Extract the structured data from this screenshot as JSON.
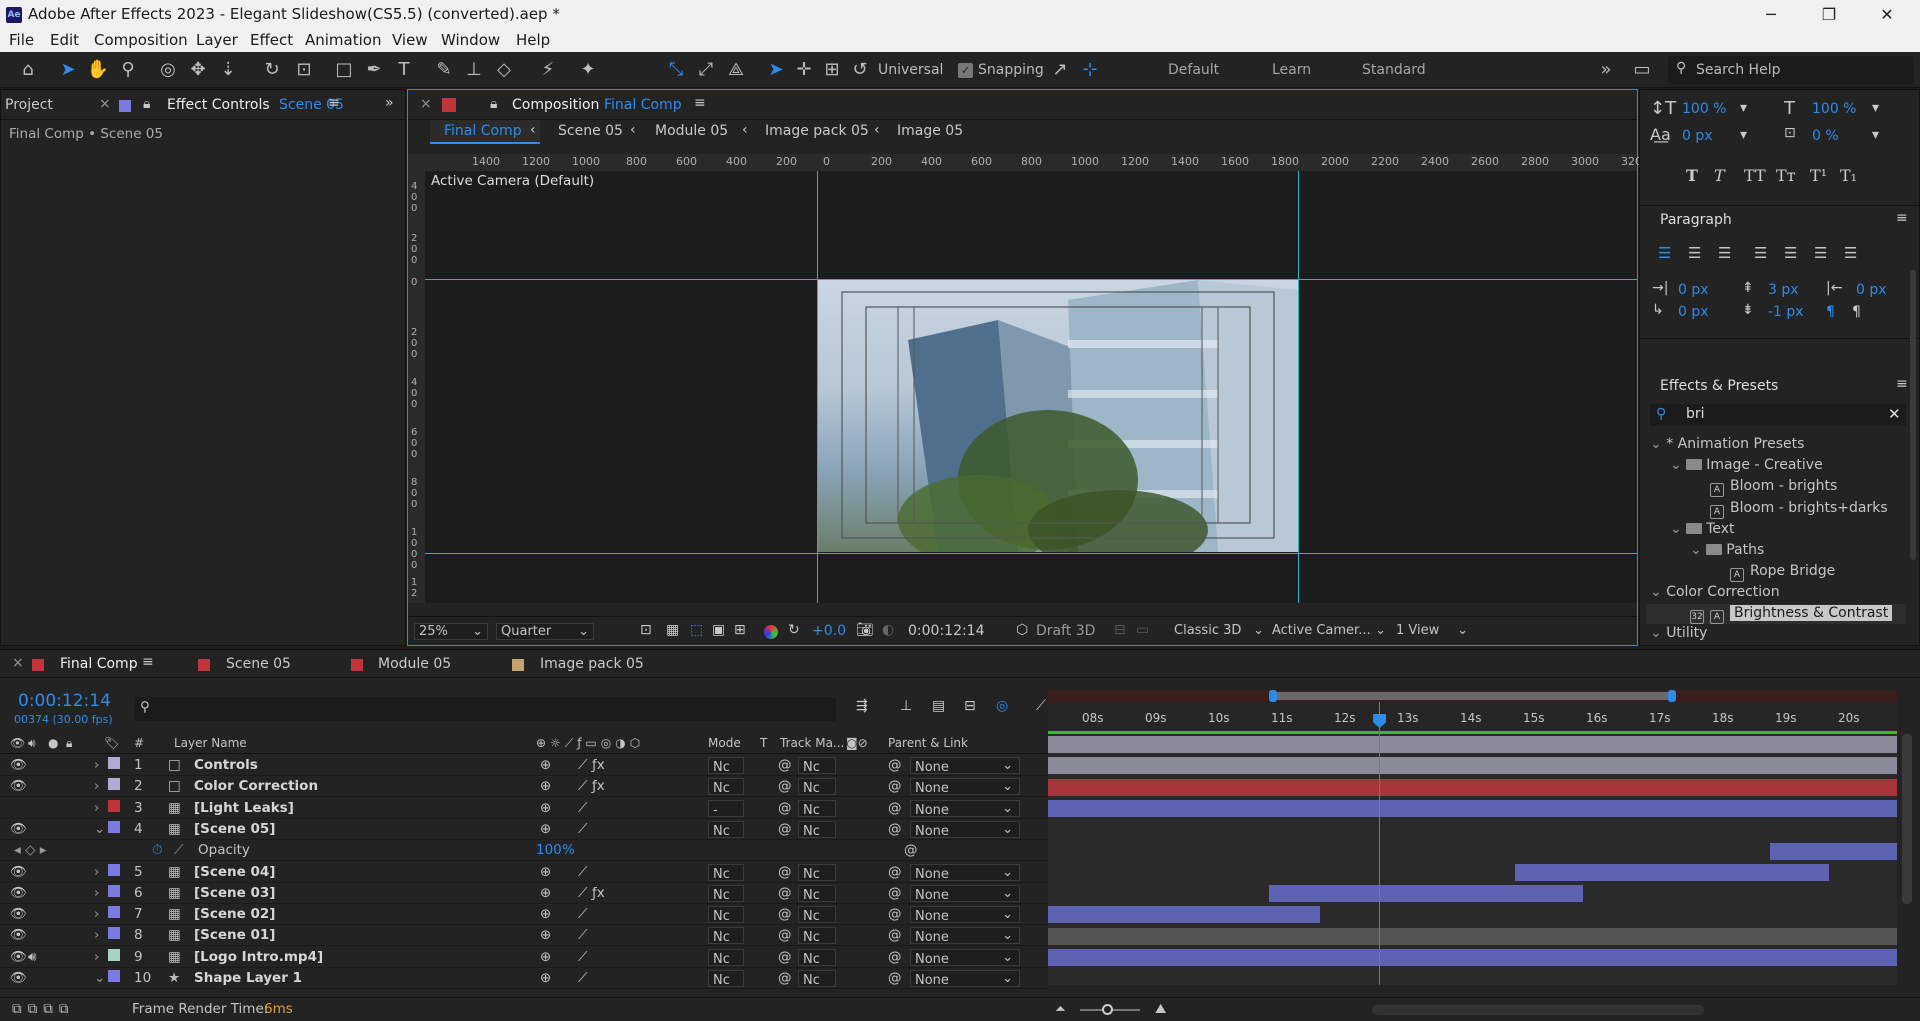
{
  "app": {
    "title": "Adobe After Effects 2023 - Elegant Slideshow(CS5.5) (converted).aep *",
    "logo": "Ae"
  },
  "window_controls": {
    "minimize": "─",
    "maximize": "❐",
    "close": "✕"
  },
  "menu": [
    "File",
    "Edit",
    "Composition",
    "Layer",
    "Effect",
    "Animation",
    "View",
    "Window",
    "Help"
  ],
  "toolbar": {
    "axis_mode": "Universal",
    "snapping": "Snapping",
    "workspaces": [
      "Default",
      "Learn",
      "Standard"
    ],
    "search_placeholder": "Search Help"
  },
  "left_panel": {
    "tab_project": "Project",
    "tab_effect_controls": "Effect Controls",
    "effect_controls_target": "Scene 05",
    "breadcrumb": "Final Comp • Scene 05"
  },
  "comp_panel": {
    "tab_label": "Composition",
    "comp_name": "Final Comp",
    "flow": [
      "Final Comp",
      "Scene 05",
      "Module 05",
      "Image pack 05",
      "Image 05"
    ],
    "camera_label": "Active Camera (Default)",
    "ruler_h": [
      "1400",
      "1200",
      "1000",
      "800",
      "600",
      "400",
      "200",
      "0",
      "200",
      "400",
      "600",
      "800",
      "1000",
      "1200",
      "1400",
      "1600",
      "1800",
      "2000",
      "2200",
      "2400",
      "2600",
      "2800",
      "3000",
      "320"
    ],
    "ruler_v": [
      "400",
      "200",
      "0",
      "200",
      "400",
      "600",
      "800",
      "1000",
      "12"
    ],
    "zoom": "25%",
    "resolution": "Quarter",
    "exposure": "+0.0",
    "timecode": "0:00:12:14",
    "renderer_draft": "Draft 3D",
    "renderer": "Classic 3D",
    "camera_select": "Active Camer...",
    "views": "1 View"
  },
  "character": {
    "vscale": "100 %",
    "hscale": "100 %",
    "baseline": "0 px",
    "tsume": "0 %",
    "styles": [
      "T",
      "T",
      "TT",
      "Tт",
      "T¹",
      "T₁"
    ]
  },
  "paragraph": {
    "title": "Paragraph",
    "indent_left": "0 px",
    "space_before": "3 px",
    "indent_right": "0 px",
    "indent_first": "0 px",
    "space_after": "-1 px"
  },
  "effects_presets": {
    "title": "Effects & Presets",
    "search": "bri",
    "tree": [
      {
        "label": "* Animation Presets",
        "level": 0,
        "kind": "group"
      },
      {
        "label": "Image - Creative",
        "level": 1,
        "kind": "folder"
      },
      {
        "label": "Bloom - brights",
        "level": 2,
        "kind": "preset"
      },
      {
        "label": "Bloom - brights+darks",
        "level": 2,
        "kind": "preset"
      },
      {
        "label": "Text",
        "level": 1,
        "kind": "folder"
      },
      {
        "label": "Paths",
        "level": 2,
        "kind": "folder"
      },
      {
        "label": "Rope Bridge",
        "level": 3,
        "kind": "preset"
      },
      {
        "label": "Color Correction",
        "level": 0,
        "kind": "group"
      },
      {
        "label": "Brightness & Contrast",
        "level": 1,
        "kind": "effect",
        "selected": true
      },
      {
        "label": "Utility",
        "level": 0,
        "kind": "group"
      }
    ]
  },
  "timeline": {
    "tabs": [
      "Final Comp",
      "Scene 05",
      "Module 05",
      "Image pack 05"
    ],
    "tab_colors": [
      "#c0343a",
      "#c0343a",
      "#c0343a",
      "#c4a46c"
    ],
    "timecode": "0:00:12:14",
    "frame_info": "00374 (30.00 fps)",
    "headers": {
      "hash": "#",
      "layer_name": "Layer Name",
      "mode": "Mode",
      "t": "T",
      "track": "Track Ma...",
      "parent": "Parent & Link"
    },
    "time_labels": [
      "08s",
      "09s",
      "10s",
      "11s",
      "12s",
      "13s",
      "14s",
      "15s",
      "16s",
      "17s",
      "18s",
      "19s",
      "20s"
    ],
    "layers": [
      {
        "num": "1",
        "name": "Controls",
        "color": "#b2a9d4",
        "mode": "Nc",
        "track": "Nc",
        "parent": "None",
        "fx": true,
        "bar": {
          "start": 0,
          "end": 1,
          "color": "#8a8a9a"
        }
      },
      {
        "num": "2",
        "name": "Color Correction",
        "color": "#b2a9d4",
        "mode": "Nc",
        "track": "Nc",
        "parent": "None",
        "fx": true,
        "bar": {
          "start": 0,
          "end": 1,
          "color": "#8a8a9a"
        }
      },
      {
        "num": "3",
        "name": "[Light Leaks]",
        "color": "#c0343a",
        "mode": "-",
        "track": "Nc",
        "parent": "None",
        "fx": false,
        "bar": {
          "start": 0,
          "end": 1,
          "color": "#a8343c"
        }
      },
      {
        "num": "4",
        "name": "[Scene 05]",
        "color": "#7a7ae0",
        "mode": "Nc",
        "track": "Nc",
        "parent": "None",
        "fx": false,
        "bar": {
          "start": 0,
          "end": 1,
          "color": "#5d62b2"
        }
      },
      {
        "num": "5",
        "name": "[Scene 04]",
        "color": "#7a7ae0",
        "mode": "Nc",
        "track": "Nc",
        "parent": "None",
        "fx": false,
        "bar": {
          "start": 0.85,
          "end": 1,
          "color": "#5d62b2"
        }
      },
      {
        "num": "6",
        "name": "[Scene 03]",
        "color": "#7a7ae0",
        "mode": "Nc",
        "track": "Nc",
        "parent": "None",
        "fx": true,
        "bar": {
          "start": 0.55,
          "end": 0.92,
          "color": "#5d62b2"
        }
      },
      {
        "num": "7",
        "name": "[Scene 02]",
        "color": "#7a7ae0",
        "mode": "Nc",
        "track": "Nc",
        "parent": "None",
        "fx": false,
        "bar": {
          "start": 0.26,
          "end": 0.63,
          "color": "#5d62b2"
        }
      },
      {
        "num": "8",
        "name": "[Scene 01]",
        "color": "#7a7ae0",
        "mode": "Nc",
        "track": "Nc",
        "parent": "None",
        "fx": false,
        "bar": {
          "start": 0,
          "end": 0.32,
          "color": "#5d62b2"
        }
      },
      {
        "num": "9",
        "name": "[Logo Intro.mp4]",
        "color": "#a6d4c4",
        "mode": "Nc",
        "track": "Nc",
        "parent": "None",
        "fx": false,
        "bar": {
          "start": 0,
          "end": 1,
          "color": "#555"
        }
      },
      {
        "num": "10",
        "name": "Shape Layer 1",
        "color": "#7a7ae0",
        "mode": "Nc",
        "track": "Nc",
        "parent": "None",
        "fx": false,
        "bar": {
          "start": 0,
          "end": 1,
          "color": "#5d62b2"
        }
      }
    ],
    "opacity": {
      "label": "Opacity",
      "value": "100",
      "unit": "%"
    },
    "playhead": 0.39,
    "frame_render_label": "Frame Render Time:",
    "frame_render_value": "6ms"
  }
}
